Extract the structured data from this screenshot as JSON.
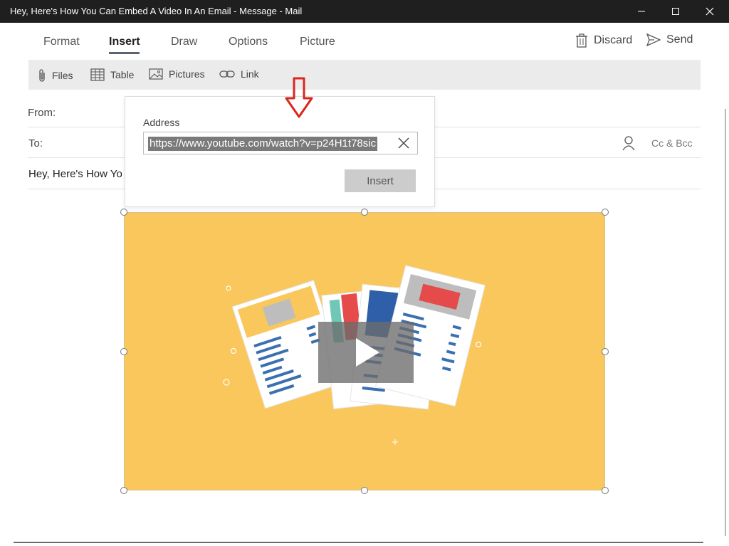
{
  "window": {
    "title": "Hey, Here's How You Can Embed A Video In An Email - Message - Mail",
    "minimize_icon": "minimize-icon",
    "maximize_icon": "maximize-icon",
    "close_icon": "close-icon"
  },
  "ribbon": {
    "tabs": [
      {
        "label": "Format"
      },
      {
        "label": "Insert"
      },
      {
        "label": "Draw"
      },
      {
        "label": "Options"
      },
      {
        "label": "Picture"
      }
    ],
    "active_tab": "Insert",
    "discard_label": "Discard",
    "send_label": "Send"
  },
  "toolbar": {
    "items": [
      {
        "label": "Files",
        "icon": "paperclip-icon"
      },
      {
        "label": "Table",
        "icon": "table-icon"
      },
      {
        "label": "Pictures",
        "icon": "picture-icon"
      },
      {
        "label": "Link",
        "icon": "link-icon"
      }
    ]
  },
  "message": {
    "from_label": "From:",
    "to_label": "To:",
    "cc_bcc_label": "Cc & Bcc",
    "subject": "Hey, Here's How Yo"
  },
  "link_popup": {
    "address_label": "Address",
    "address_value": "https://www.youtube.com/watch?v=p24H1t78sic",
    "insert_label": "Insert"
  },
  "colors": {
    "titlebar": "#1f1f1f",
    "toolbar_bg": "#ebebeb",
    "thumbnail_bg": "#f9c75c",
    "annotation_arrow": "#d9271e"
  }
}
